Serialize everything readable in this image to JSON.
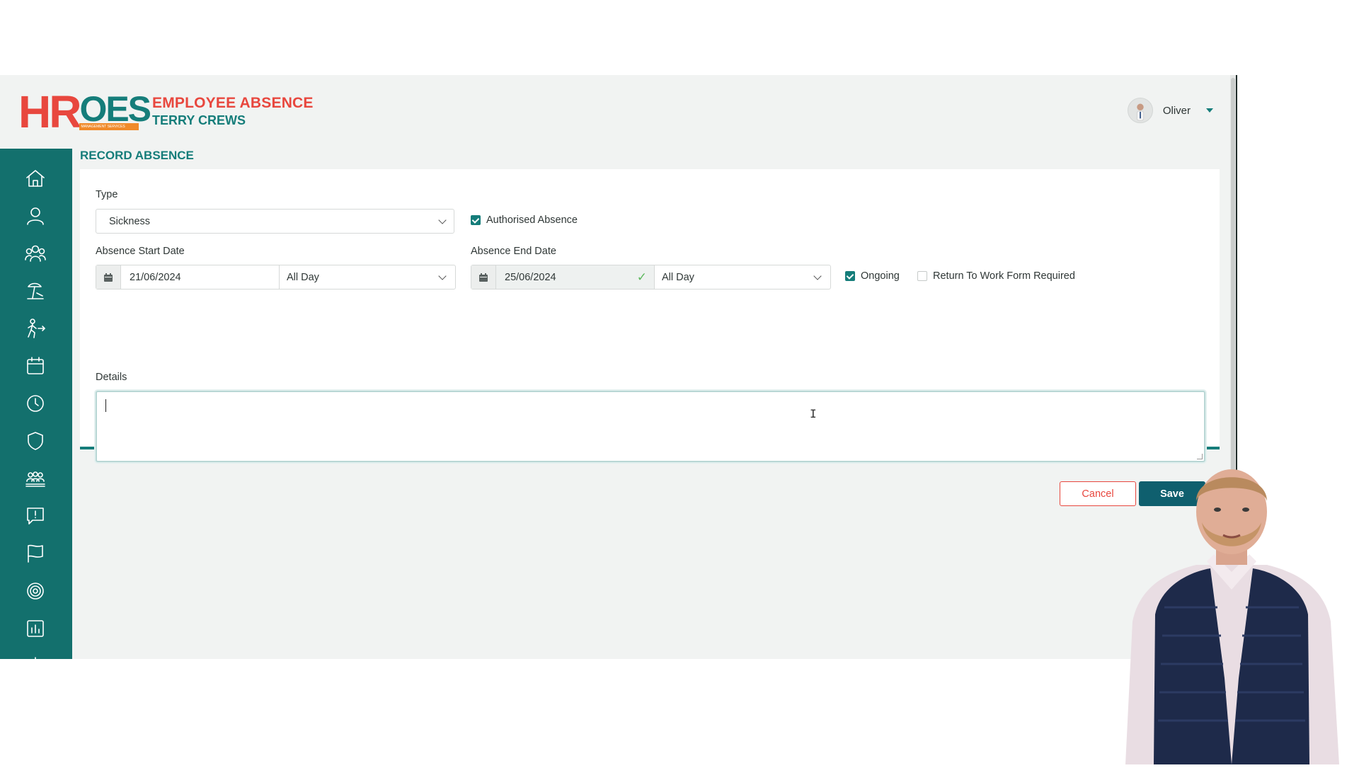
{
  "header": {
    "logo_hr": "HR",
    "logo_oes": "OES",
    "logo_sub": "MANAGEMENT SERVICES",
    "title": "EMPLOYEE ABSENCE",
    "subtitle": "TERRY CREWS"
  },
  "user": {
    "name": "Oliver"
  },
  "sidebar": {
    "icons": [
      "home-icon",
      "user-icon",
      "team-icon",
      "holiday-icon",
      "leaver-icon",
      "calendar-icon",
      "clock-icon",
      "shield-icon",
      "group-icon",
      "alert-message-icon",
      "flag-icon",
      "target-icon",
      "report-icon",
      "balance-icon"
    ]
  },
  "form": {
    "section_title": "RECORD ABSENCE",
    "type_label": "Type",
    "type_value": "Sickness",
    "authorised_label": "Authorised Absence",
    "authorised_checked": true,
    "start_label": "Absence Start Date",
    "start_date": "21/06/2024",
    "start_period": "All Day",
    "end_label": "Absence End Date",
    "end_date": "25/06/2024",
    "end_period": "All Day",
    "ongoing_label": "Ongoing",
    "ongoing_checked": true,
    "rtw_label": "Return To Work Form Required",
    "rtw_checked": false,
    "details_label": "Details",
    "details_value": "",
    "cancel_label": "Cancel",
    "save_label": "Save"
  },
  "colors": {
    "brand_red": "#e8473e",
    "brand_teal": "#157d7a",
    "sidebar": "#13706d",
    "save_button": "#0f5f6e"
  }
}
